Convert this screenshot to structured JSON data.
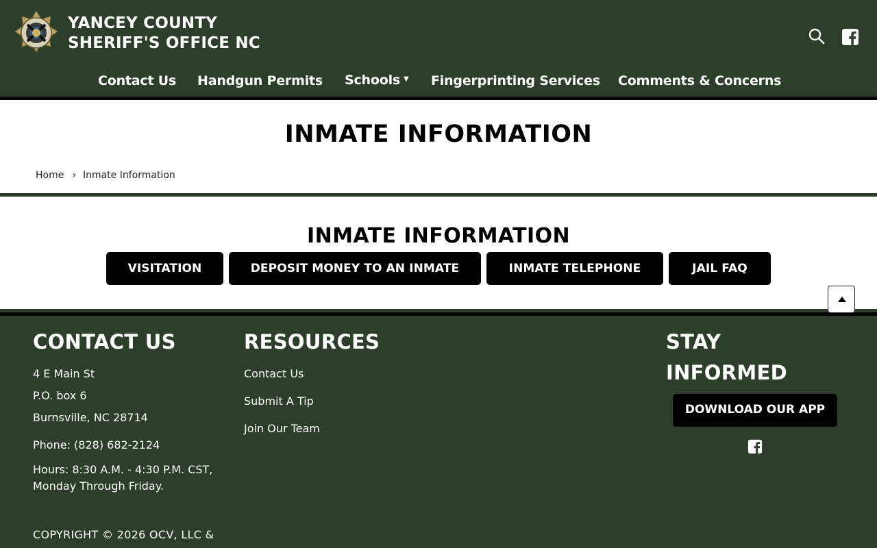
{
  "header": {
    "title_line1": "YANCEY COUNTY",
    "title_line2": "SHERIFF'S OFFICE NC",
    "logo_icon": "sheriff-badge-logo",
    "search_icon": "search-icon",
    "facebook_icon": "facebook-icon"
  },
  "nav": {
    "items": [
      {
        "label": "Contact Us"
      },
      {
        "label": "Handgun Permits"
      },
      {
        "label": "Schools",
        "has_dropdown": true
      },
      {
        "label": "Fingerprinting Services"
      },
      {
        "label": "Comments & Concerns"
      }
    ]
  },
  "page": {
    "title": "INMATE INFORMATION",
    "breadcrumb": {
      "home": "Home",
      "separator": "›",
      "current": "Inmate Information"
    }
  },
  "content": {
    "section_title": "INMATE INFORMATION",
    "buttons": [
      {
        "label": "VISITATION"
      },
      {
        "label": "DEPOSIT MONEY TO AN INMATE"
      },
      {
        "label": "INMATE TELEPHONE"
      },
      {
        "label": "JAIL FAQ"
      }
    ]
  },
  "footer": {
    "contact": {
      "heading": "CONTACT US",
      "address1": "4 E Main St",
      "address2": "P.O. box 6",
      "address3": "Burnsville, NC 28714",
      "phone": "Phone: (828) 682-2124",
      "hours1": "Hours: 8:30 A.M. - 4:30 P.M. CST,",
      "hours2": "Monday Through Friday."
    },
    "resources": {
      "heading": "RESOURCES",
      "links": [
        {
          "label": "Contact Us"
        },
        {
          "label": "Submit A Tip"
        },
        {
          "label": "Join Our Team"
        }
      ]
    },
    "stay": {
      "heading_line1": "STAY",
      "heading_line2": "INFORMED",
      "app_button": "DOWNLOAD OUR APP"
    },
    "copyright": "COPYRIGHT © 2026 OCV, LLC &"
  },
  "colors": {
    "brand_green": "#2d3e2a",
    "button_black": "#000000",
    "white": "#ffffff"
  }
}
